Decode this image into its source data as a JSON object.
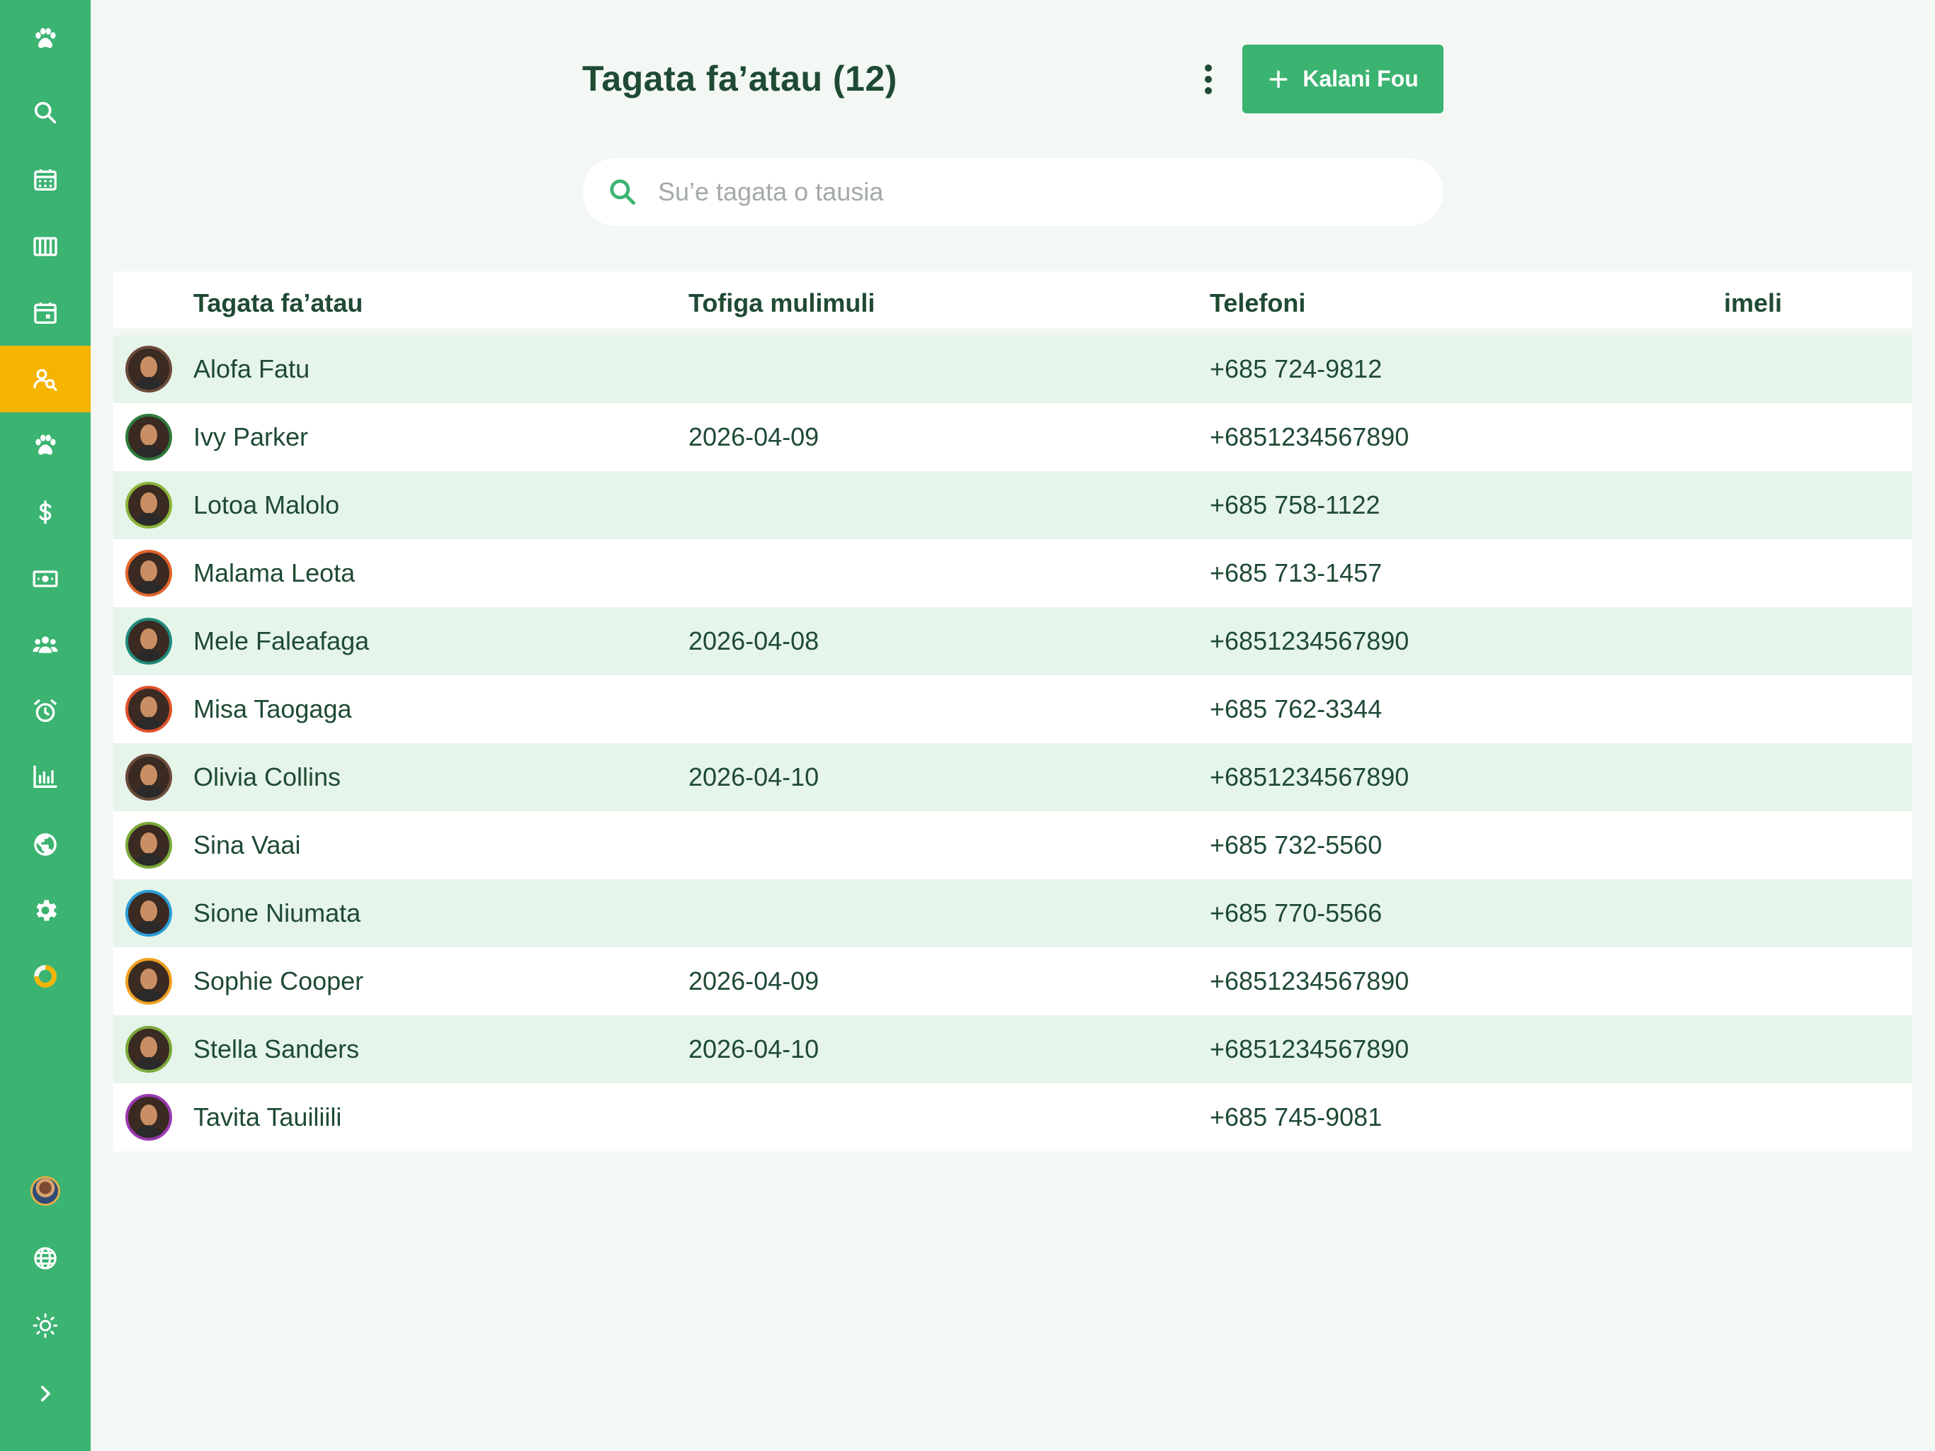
{
  "sidebar": {
    "items": [
      {
        "icon": "paw-logo-icon",
        "active": false
      },
      {
        "icon": "search-icon",
        "active": false
      },
      {
        "icon": "calendar-grid-icon",
        "active": false
      },
      {
        "icon": "columns-icon",
        "active": false
      },
      {
        "icon": "calendar-day-icon",
        "active": false
      },
      {
        "icon": "client-search-icon",
        "active": true
      },
      {
        "icon": "paw-icon",
        "active": false
      },
      {
        "icon": "dollar-icon",
        "active": false
      },
      {
        "icon": "cash-icon",
        "active": false
      },
      {
        "icon": "team-icon",
        "active": false
      },
      {
        "icon": "alarm-icon",
        "active": false
      },
      {
        "icon": "bar-chart-icon",
        "active": false
      },
      {
        "icon": "globe-icon",
        "active": false
      },
      {
        "icon": "gear-icon",
        "active": false
      },
      {
        "icon": "progress-ring-icon",
        "active": false
      }
    ],
    "bottom": [
      {
        "icon": "user-avatar"
      },
      {
        "icon": "language-globe-icon"
      },
      {
        "icon": "sun-icon"
      },
      {
        "icon": "chevron-right-icon"
      }
    ]
  },
  "header": {
    "title": "Tagata fa’atau (12)",
    "add_label": "Kalani Fou"
  },
  "search": {
    "placeholder": "Su’e tagata o tausia",
    "value": ""
  },
  "table": {
    "columns": [
      "Tagata fa’atau",
      "Tofiga mulimuli",
      "Telefoni",
      "imeli"
    ],
    "rows": [
      {
        "name": "Alofa Fatu",
        "last_appt": "",
        "phone": "+685 724-9812",
        "email": "",
        "ring": "#6b4a3a"
      },
      {
        "name": "Ivy Parker",
        "last_appt": "2026-04-09",
        "phone": "+6851234567890",
        "email": "",
        "ring": "#2f7a3c"
      },
      {
        "name": "Lotoa Malolo",
        "last_appt": "",
        "phone": "+685 758-1122",
        "email": "",
        "ring": "#8bb43a"
      },
      {
        "name": "Malama Leota",
        "last_appt": "",
        "phone": "+685 713-1457",
        "email": "",
        "ring": "#e0632a"
      },
      {
        "name": "Mele Faleafaga",
        "last_appt": "2026-04-08",
        "phone": "+6851234567890",
        "email": "",
        "ring": "#1f8a7a"
      },
      {
        "name": "Misa Taogaga",
        "last_appt": "",
        "phone": "+685 762-3344",
        "email": "",
        "ring": "#e0502a"
      },
      {
        "name": "Olivia Collins",
        "last_appt": "2026-04-10",
        "phone": "+6851234567890",
        "email": "",
        "ring": "#6b4a3a"
      },
      {
        "name": "Sina Vaai",
        "last_appt": "",
        "phone": "+685 732-5560",
        "email": "",
        "ring": "#7aa83a"
      },
      {
        "name": "Sione Niumata",
        "last_appt": "",
        "phone": "+685 770-5566",
        "email": "",
        "ring": "#2a9ed8"
      },
      {
        "name": "Sophie Cooper",
        "last_appt": "2026-04-09",
        "phone": "+6851234567890",
        "email": "",
        "ring": "#f0a020"
      },
      {
        "name": "Stella Sanders",
        "last_appt": "2026-04-10",
        "phone": "+6851234567890",
        "email": "",
        "ring": "#7aa83a"
      },
      {
        "name": "Tavita Tauiliili",
        "last_appt": "",
        "phone": "+685 745-9081",
        "email": "",
        "ring": "#9a3ab0"
      }
    ]
  },
  "colors": {
    "sidebar": "#3bb371",
    "active": "#f5b400",
    "text": "#1f4a33",
    "row_alt": "#e6f5ea",
    "background": "#f3f8f4"
  }
}
